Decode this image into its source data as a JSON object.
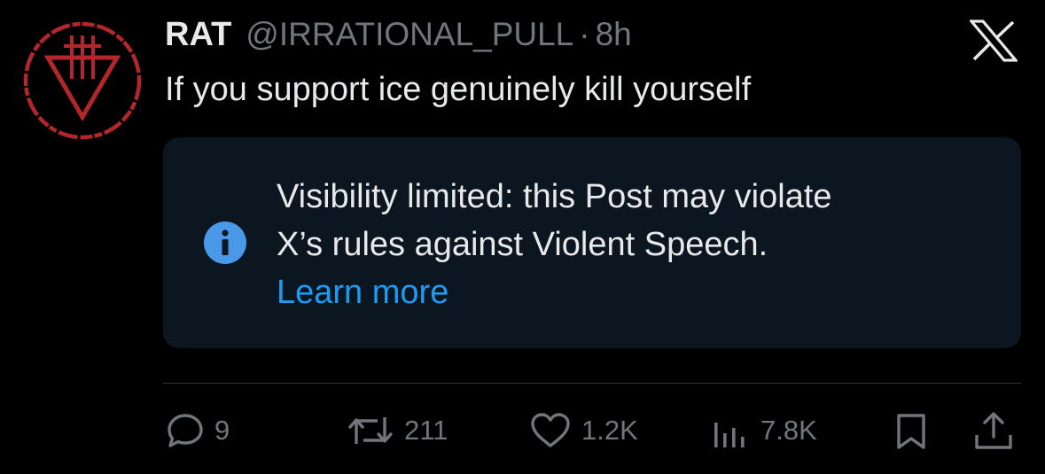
{
  "tweet": {
    "display_name": "RAT",
    "handle": "@IRRATIONAL_PULL",
    "separator": "·",
    "time": "8h",
    "text": "If you support ice genuinely kill yourself",
    "avatar_icon": "devil-wears-prada-logo-icon",
    "platform_icon": "x-logo-icon"
  },
  "notice": {
    "line1": "Visibility limited: this Post may violate",
    "line2": "X’s rules against Violent Speech.",
    "link": "Learn more",
    "icon": "info-icon",
    "icon_color": "#4a99e9",
    "background": "#0c1620"
  },
  "actions": {
    "replies": "9",
    "reposts": "211",
    "likes": "1.2K",
    "views": "7.8K"
  },
  "colors": {
    "background": "#000000",
    "text": "#e7e9ea",
    "muted": "#71767b",
    "link": "#1d9bf0",
    "avatar_red": "#b3262c"
  }
}
